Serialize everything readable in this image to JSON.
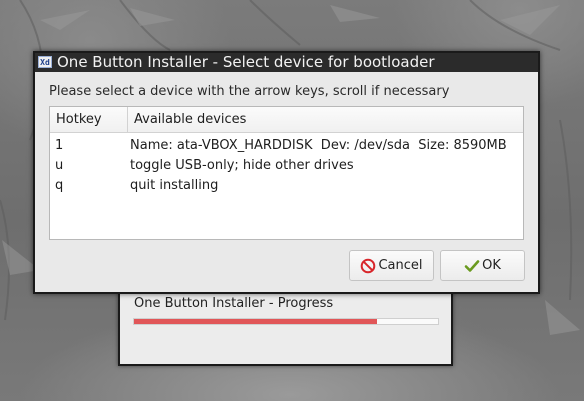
{
  "dialog": {
    "title": "One Button Installer - Select device for bootloader",
    "icon_text": "Xd",
    "instructions": "Please select a device with the arrow keys, scroll if necessary",
    "columns": {
      "hotkey": "Hotkey",
      "devices": "Available devices"
    },
    "rows": [
      {
        "hotkey": "1",
        "description": "Name: ata-VBOX_HARDDISK  Dev: /dev/sda  Size: 8590MB"
      },
      {
        "hotkey": "u",
        "description": "toggle USB-only; hide other drives"
      },
      {
        "hotkey": "q",
        "description": "quit installing"
      }
    ],
    "buttons": {
      "cancel": "Cancel",
      "ok": "OK"
    }
  },
  "progress_window": {
    "title": "One Button Installer - Progress",
    "progress_percent": 80
  },
  "colors": {
    "progress_fill": "#e15658",
    "cancel_icon": "#d8262b",
    "ok_icon": "#6a9a1f",
    "titlebar": "#2b2b2b"
  },
  "icons": [
    "window-app-icon",
    "cancel-icon",
    "checkmark-icon"
  ]
}
